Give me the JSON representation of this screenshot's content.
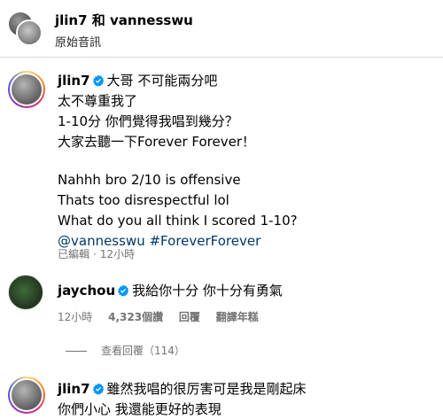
{
  "header": {
    "user1": "jlin7",
    "conj": "和",
    "user2": "vannesswu",
    "subtitle": "原始音訊"
  },
  "comments": [
    {
      "username": "jlin7",
      "lines": [
        "大哥 不可能兩分吧",
        "太不尊重我了",
        "1-10分 你們覺得我唱到幾分？",
        "大家去聽一下Forever Forever！"
      ],
      "lines_en": [
        "Nahhh bro 2/10 is offensive",
        "Thats too disrespectful lol",
        "What do you all think I scored 1-10?"
      ],
      "link_text": "@vannesswu #ForeverForever",
      "edited": "已編輯",
      "time": "12小時"
    },
    {
      "username": "jaychou",
      "text": "我給你十分 你十分有勇氣",
      "time": "12小時",
      "likes": "4,323個讚",
      "reply": "回覆",
      "translate": "翻譯年糕",
      "view_replies": "查看回覆（114）"
    },
    {
      "username": "jlin7",
      "lines": [
        "雖然我唱的很厉害可是我是剛起床",
        "你們小心 我還能更好的表現"
      ]
    }
  ],
  "colors": {
    "verified": "#0095f6",
    "link": "#00376b",
    "meta": "#737373"
  }
}
